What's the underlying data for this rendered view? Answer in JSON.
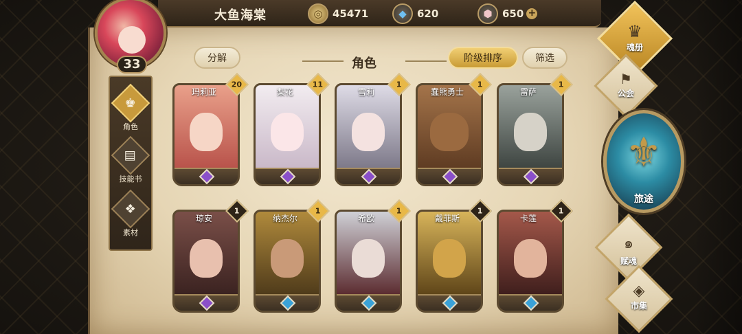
{
  "player": {
    "name": "大鱼海棠",
    "level": "33"
  },
  "resources": [
    {
      "icon": "gold-coin-icon",
      "value": "45471"
    },
    {
      "icon": "blue-crystal-icon",
      "value": "620"
    },
    {
      "icon": "pink-gem-icon",
      "value": "650"
    }
  ],
  "left_nav": [
    {
      "label": "角色",
      "icon": "character-icon",
      "active": true
    },
    {
      "label": "技能书",
      "icon": "skillbook-icon",
      "active": false
    },
    {
      "label": "素材",
      "icon": "material-icon",
      "active": false
    }
  ],
  "header": {
    "decompose": "分解",
    "title": "角色",
    "sort": "阶级排序",
    "filter": "筛选"
  },
  "cards": [
    {
      "name": "玛莉亚",
      "count": "20",
      "badge": "gold",
      "gem": "purple",
      "art": "#e2876f"
    },
    {
      "name": "梨花",
      "count": "11",
      "badge": "gold",
      "gem": "purple",
      "art": "#e6d9e4"
    },
    {
      "name": "雪莉",
      "count": "1",
      "badge": "gold",
      "gem": "purple",
      "art": "#c9c6d4"
    },
    {
      "name": "蠢熊勇士",
      "count": "1",
      "badge": "gold",
      "gem": "purple",
      "art": "#8a5a36"
    },
    {
      "name": "雷萨",
      "count": "1",
      "badge": "gold",
      "gem": "purple",
      "art": "#7d847e"
    },
    {
      "name": "琼安",
      "count": "1",
      "badge": "dark",
      "gem": "purple",
      "art": "#6b3f3a"
    },
    {
      "name": "纳杰尔",
      "count": "1",
      "badge": "gold",
      "gem": "blue",
      "art": "#8c6a2c"
    },
    {
      "name": "希欧",
      "count": "1",
      "badge": "gold",
      "gem": "blue",
      "art": "#a8a9b1"
    },
    {
      "name": "戴菲斯",
      "count": "1",
      "badge": "dark",
      "gem": "blue",
      "art": "#b88c32"
    },
    {
      "name": "卡莲",
      "count": "1",
      "badge": "dark",
      "gem": "blue",
      "art": "#8c4d40"
    }
  ],
  "right_nav": {
    "soul_book": "魂册",
    "guild": "公会",
    "journey": "旅途",
    "soul_gift": "赋魂",
    "market": "市集"
  }
}
